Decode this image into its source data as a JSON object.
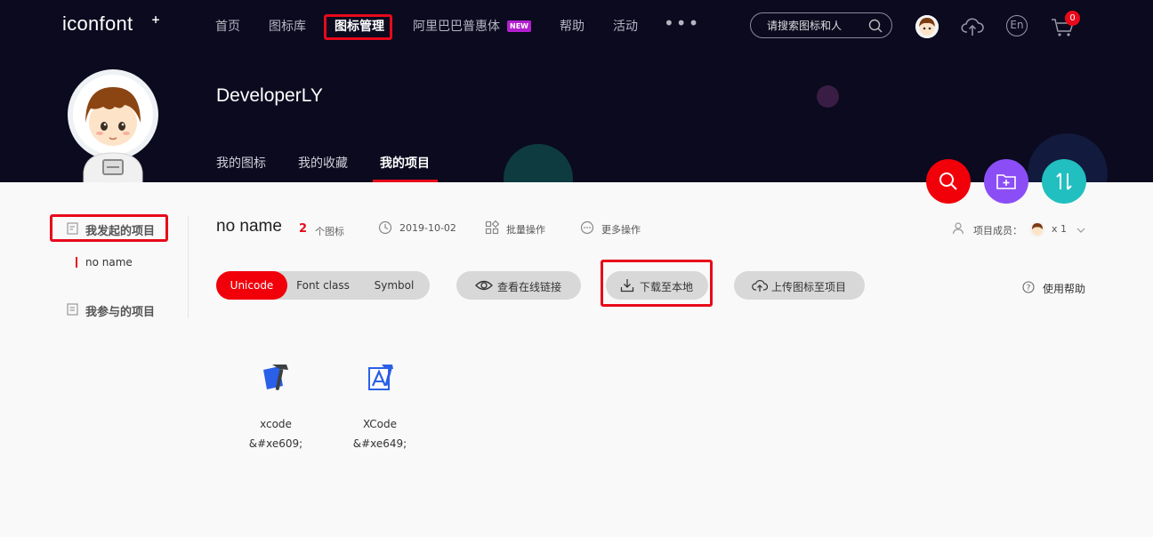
{
  "brand": {
    "logo": "iconfont",
    "logo_suffix": "+"
  },
  "nav": {
    "items": [
      "首页",
      "图标库",
      "图标管理",
      "阿里巴巴普惠体",
      "帮助",
      "活动"
    ],
    "active": "图标管理",
    "new_badge": "NEW",
    "more": "•••"
  },
  "search": {
    "placeholder": "请搜索图标和人"
  },
  "header_icons": [
    "avatar",
    "upload-cloud-icon",
    "language-en-icon",
    "cart-icon"
  ],
  "language": "En",
  "cart": {
    "count": "0"
  },
  "profile": {
    "username": "DeveloperLY",
    "tabs": [
      "我的图标",
      "我的收藏",
      "我的项目"
    ],
    "active_tab": "我的项目"
  },
  "sidebar": {
    "created_projects": "我发起的项目",
    "current_project": "no name",
    "joined_projects": "我参与的项目"
  },
  "project": {
    "name": "no name",
    "icon_count": "2",
    "icon_unit": "个图标",
    "date": "2019-10-02",
    "batch_ops": "批量操作",
    "more_ops": "更多操作",
    "members_label": "项目成员：",
    "members_count": "x 1"
  },
  "format_tabs": [
    "Unicode",
    "Font class",
    "Symbol"
  ],
  "active_format": "Unicode",
  "actions": {
    "view_online": "查看在线链接",
    "download": "下载至本地",
    "upload": "上传图标至项目",
    "help": "使用帮助"
  },
  "icons": [
    {
      "name": "xcode",
      "code": "&#xe609;"
    },
    {
      "name": "XCode",
      "code": "&#xe649;"
    }
  ],
  "colors": {
    "header_bg": "#0b0a1f",
    "accent_red": "#f1000a",
    "fab_purple": "#8b4ef6",
    "fab_teal": "#21bfbf",
    "icon_blue": "#2a5fe8",
    "new_badge": "#b31fcf"
  }
}
